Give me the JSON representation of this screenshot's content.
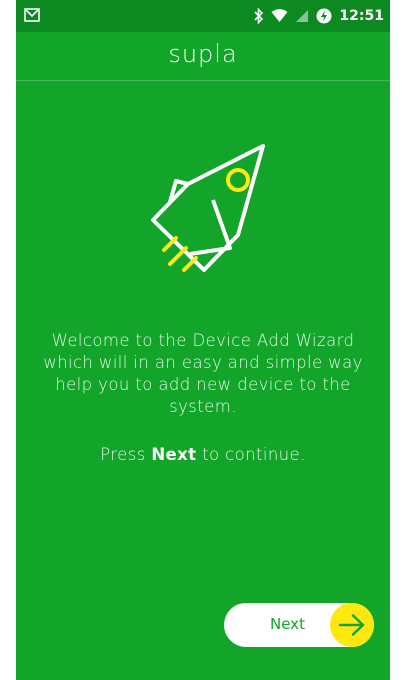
{
  "status_bar": {
    "time": "12:51",
    "icons": [
      "gmail-notification-icon",
      "bluetooth-icon",
      "wifi-icon",
      "no-sim-icon",
      "battery-saver-icon"
    ]
  },
  "app": {
    "title": "supla"
  },
  "illustration": {
    "icon": "rocket-icon",
    "colors": {
      "outline": "#ffffff",
      "accent": "#ffe80f"
    }
  },
  "wizard": {
    "welcome_text": "Welcome to the Device Add Wizard which will in an easy and simple way help you to add new device to the system.",
    "press_prefix": "Press ",
    "press_keyword": "Next",
    "press_suffix": " to continue."
  },
  "next_button": {
    "label": "Next",
    "icon": "arrow-right-icon"
  },
  "colors": {
    "background": "#12a52a",
    "status_bar": "#0c8a21",
    "accent": "#ffe80f",
    "button_bg": "#ffffff"
  }
}
